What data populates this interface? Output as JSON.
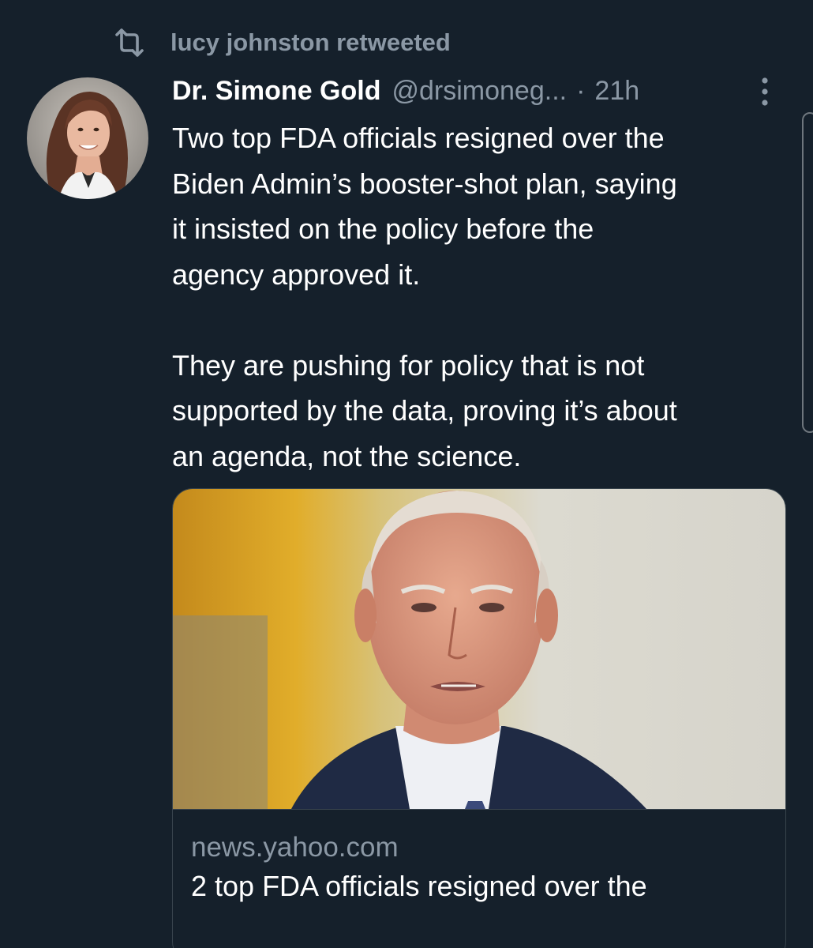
{
  "retweet_banner": {
    "text": "lucy johnston retweeted",
    "icon": "retweet-icon"
  },
  "tweet": {
    "author_name": "Dr. Simone Gold",
    "handle": "@drsimoneg...",
    "separator": "·",
    "time_ago": "21h",
    "body": "Two top FDA officials resigned over the\nBiden Admin’s booster-shot plan, saying\nit insisted on the policy before the\nagency approved it.\n\nThey are pushing for policy that is not\nsupported by the data, proving it’s about\nan agenda, not the science.",
    "more_icon": "more-vertical-icon",
    "avatar_icon": "avatar-photo"
  },
  "link_card": {
    "domain": "news.yahoo.com",
    "title": "2 top FDA officials resigned over the",
    "image": "news-photo"
  },
  "colors": {
    "background": "#15202b",
    "text_primary": "#ffffff",
    "text_secondary": "#8b98a5",
    "border": "#38444d"
  }
}
